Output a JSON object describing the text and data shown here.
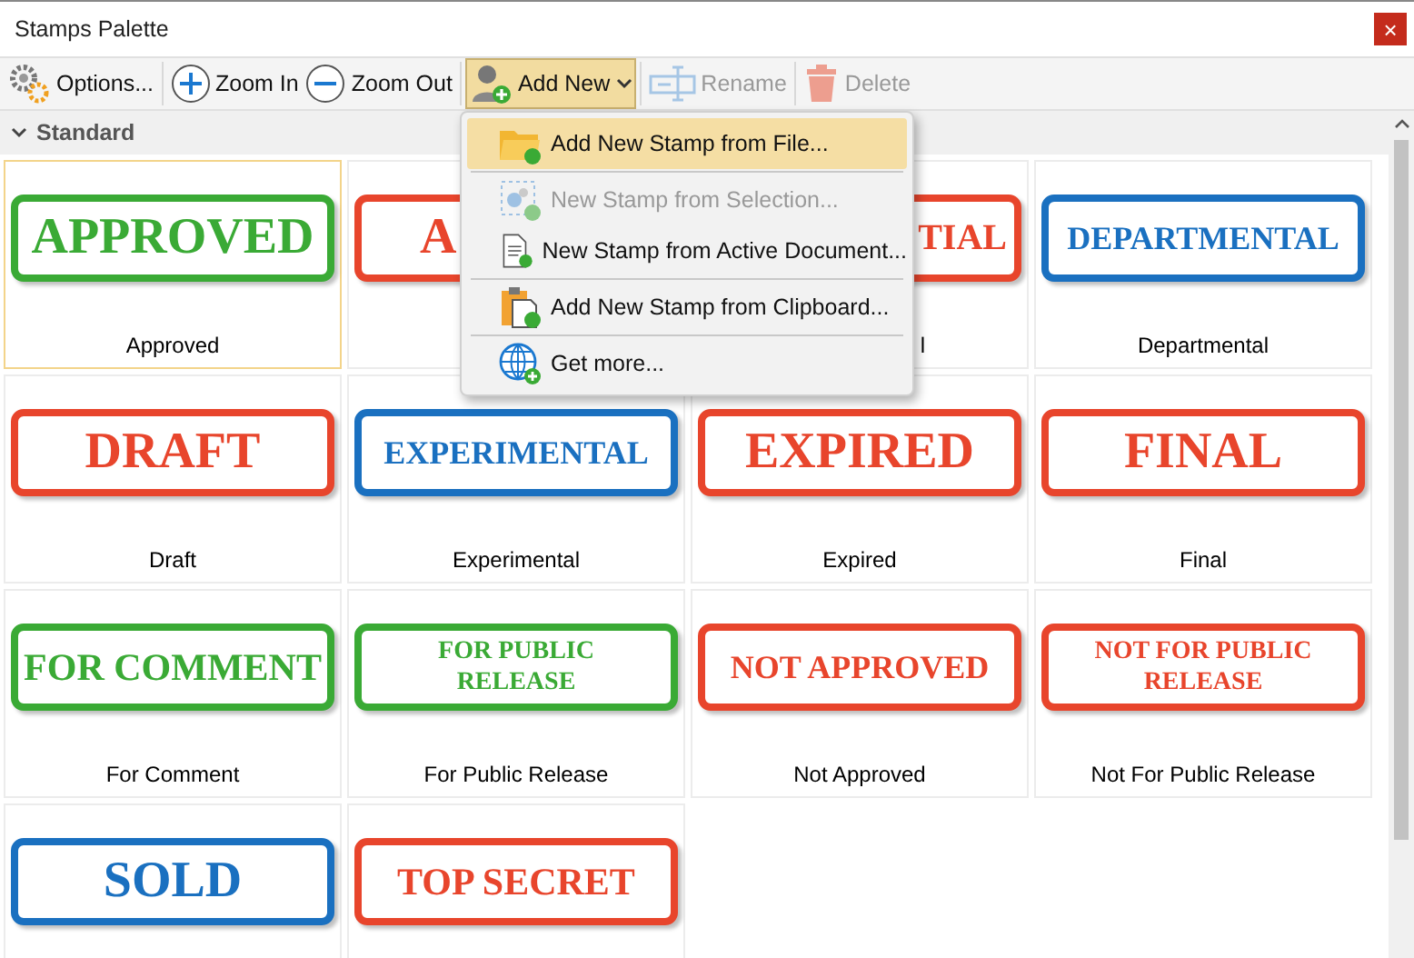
{
  "window": {
    "title": "Stamps Palette",
    "close": "×"
  },
  "toolbar": [
    {
      "kind": "gear",
      "label": "Options...",
      "disabled": false,
      "pressed": false,
      "caret": false
    },
    {
      "kind": "plus",
      "label": "Zoom In",
      "disabled": false,
      "pressed": false,
      "caret": false
    },
    {
      "kind": "minus",
      "label": "Zoom Out",
      "disabled": false,
      "pressed": false,
      "caret": false
    },
    {
      "kind": "person",
      "label": "Add New",
      "disabled": false,
      "pressed": true,
      "caret": true
    },
    {
      "kind": "rename",
      "label": "Rename",
      "disabled": true,
      "pressed": false,
      "caret": false
    },
    {
      "kind": "trash",
      "label": "Delete",
      "disabled": true,
      "pressed": false,
      "caret": false
    }
  ],
  "group": {
    "title": "Standard",
    "expanded": true
  },
  "stamps": [
    {
      "kind": "stamp",
      "stamp_text": "APPROVED",
      "label": "Approved",
      "color": "#3aaa35",
      "selected": true
    },
    {
      "kind": "right_covered",
      "stamp_text": "A",
      "color": "#e8452c",
      "selected": false
    },
    {
      "kind": "left_covered",
      "stamp_text": "TIAL",
      "label": "l",
      "color": "#e8452c",
      "selected": false
    },
    {
      "kind": "stamp",
      "stamp_text": "DEPARTMENTAL",
      "label": "Departmental",
      "color": "#1a70c0",
      "selected": false
    },
    {
      "kind": "stamp",
      "stamp_text": "DRAFT",
      "label": "Draft",
      "color": "#e8452c",
      "selected": false
    },
    {
      "kind": "stamp",
      "stamp_text": "EXPERIMENTAL",
      "label": "Experimental",
      "color": "#1a70c0",
      "selected": false
    },
    {
      "kind": "stamp",
      "stamp_text": "EXPIRED",
      "label": "Expired",
      "color": "#e8452c",
      "selected": false
    },
    {
      "kind": "stamp",
      "stamp_text": "FINAL",
      "label": "Final",
      "color": "#e8452c",
      "selected": false
    },
    {
      "kind": "stamp",
      "stamp_text": "FOR COMMENT",
      "label": "For Comment",
      "color": "#3aaa35",
      "selected": false
    },
    {
      "kind": "stamp",
      "stamp_lines": [
        "FOR PUBLIC",
        "RELEASE"
      ],
      "label": "For Public Release",
      "color": "#3aaa35",
      "selected": false
    },
    {
      "kind": "stamp",
      "stamp_text": "NOT APPROVED",
      "label": "Not Approved",
      "color": "#e8452c",
      "selected": false
    },
    {
      "kind": "stamp",
      "stamp_lines": [
        "NOT FOR PUBLIC",
        "RELEASE"
      ],
      "label": "Not For Public Release",
      "color": "#e8452c",
      "selected": false
    },
    {
      "kind": "stamp",
      "stamp_text": "SOLD",
      "color": "#1a70c0",
      "selected": false
    },
    {
      "kind": "stamp",
      "stamp_text": "TOP SECRET",
      "color": "#e8452c",
      "selected": false
    }
  ],
  "menu": [
    {
      "kind": "folder",
      "label": "Add New Stamp from File...",
      "selected": true,
      "disabled": false
    },
    {
      "kind": "selection",
      "label": "New Stamp from Selection...",
      "selected": false,
      "disabled": true
    },
    {
      "kind": "document",
      "label": "New Stamp from Active Document...",
      "selected": false,
      "disabled": false
    },
    {
      "kind": "clipboard",
      "label": "Add New Stamp from Clipboard...",
      "selected": false,
      "disabled": false
    },
    {
      "kind": "globe",
      "label": "Get more...",
      "selected": false,
      "disabled": false
    }
  ]
}
